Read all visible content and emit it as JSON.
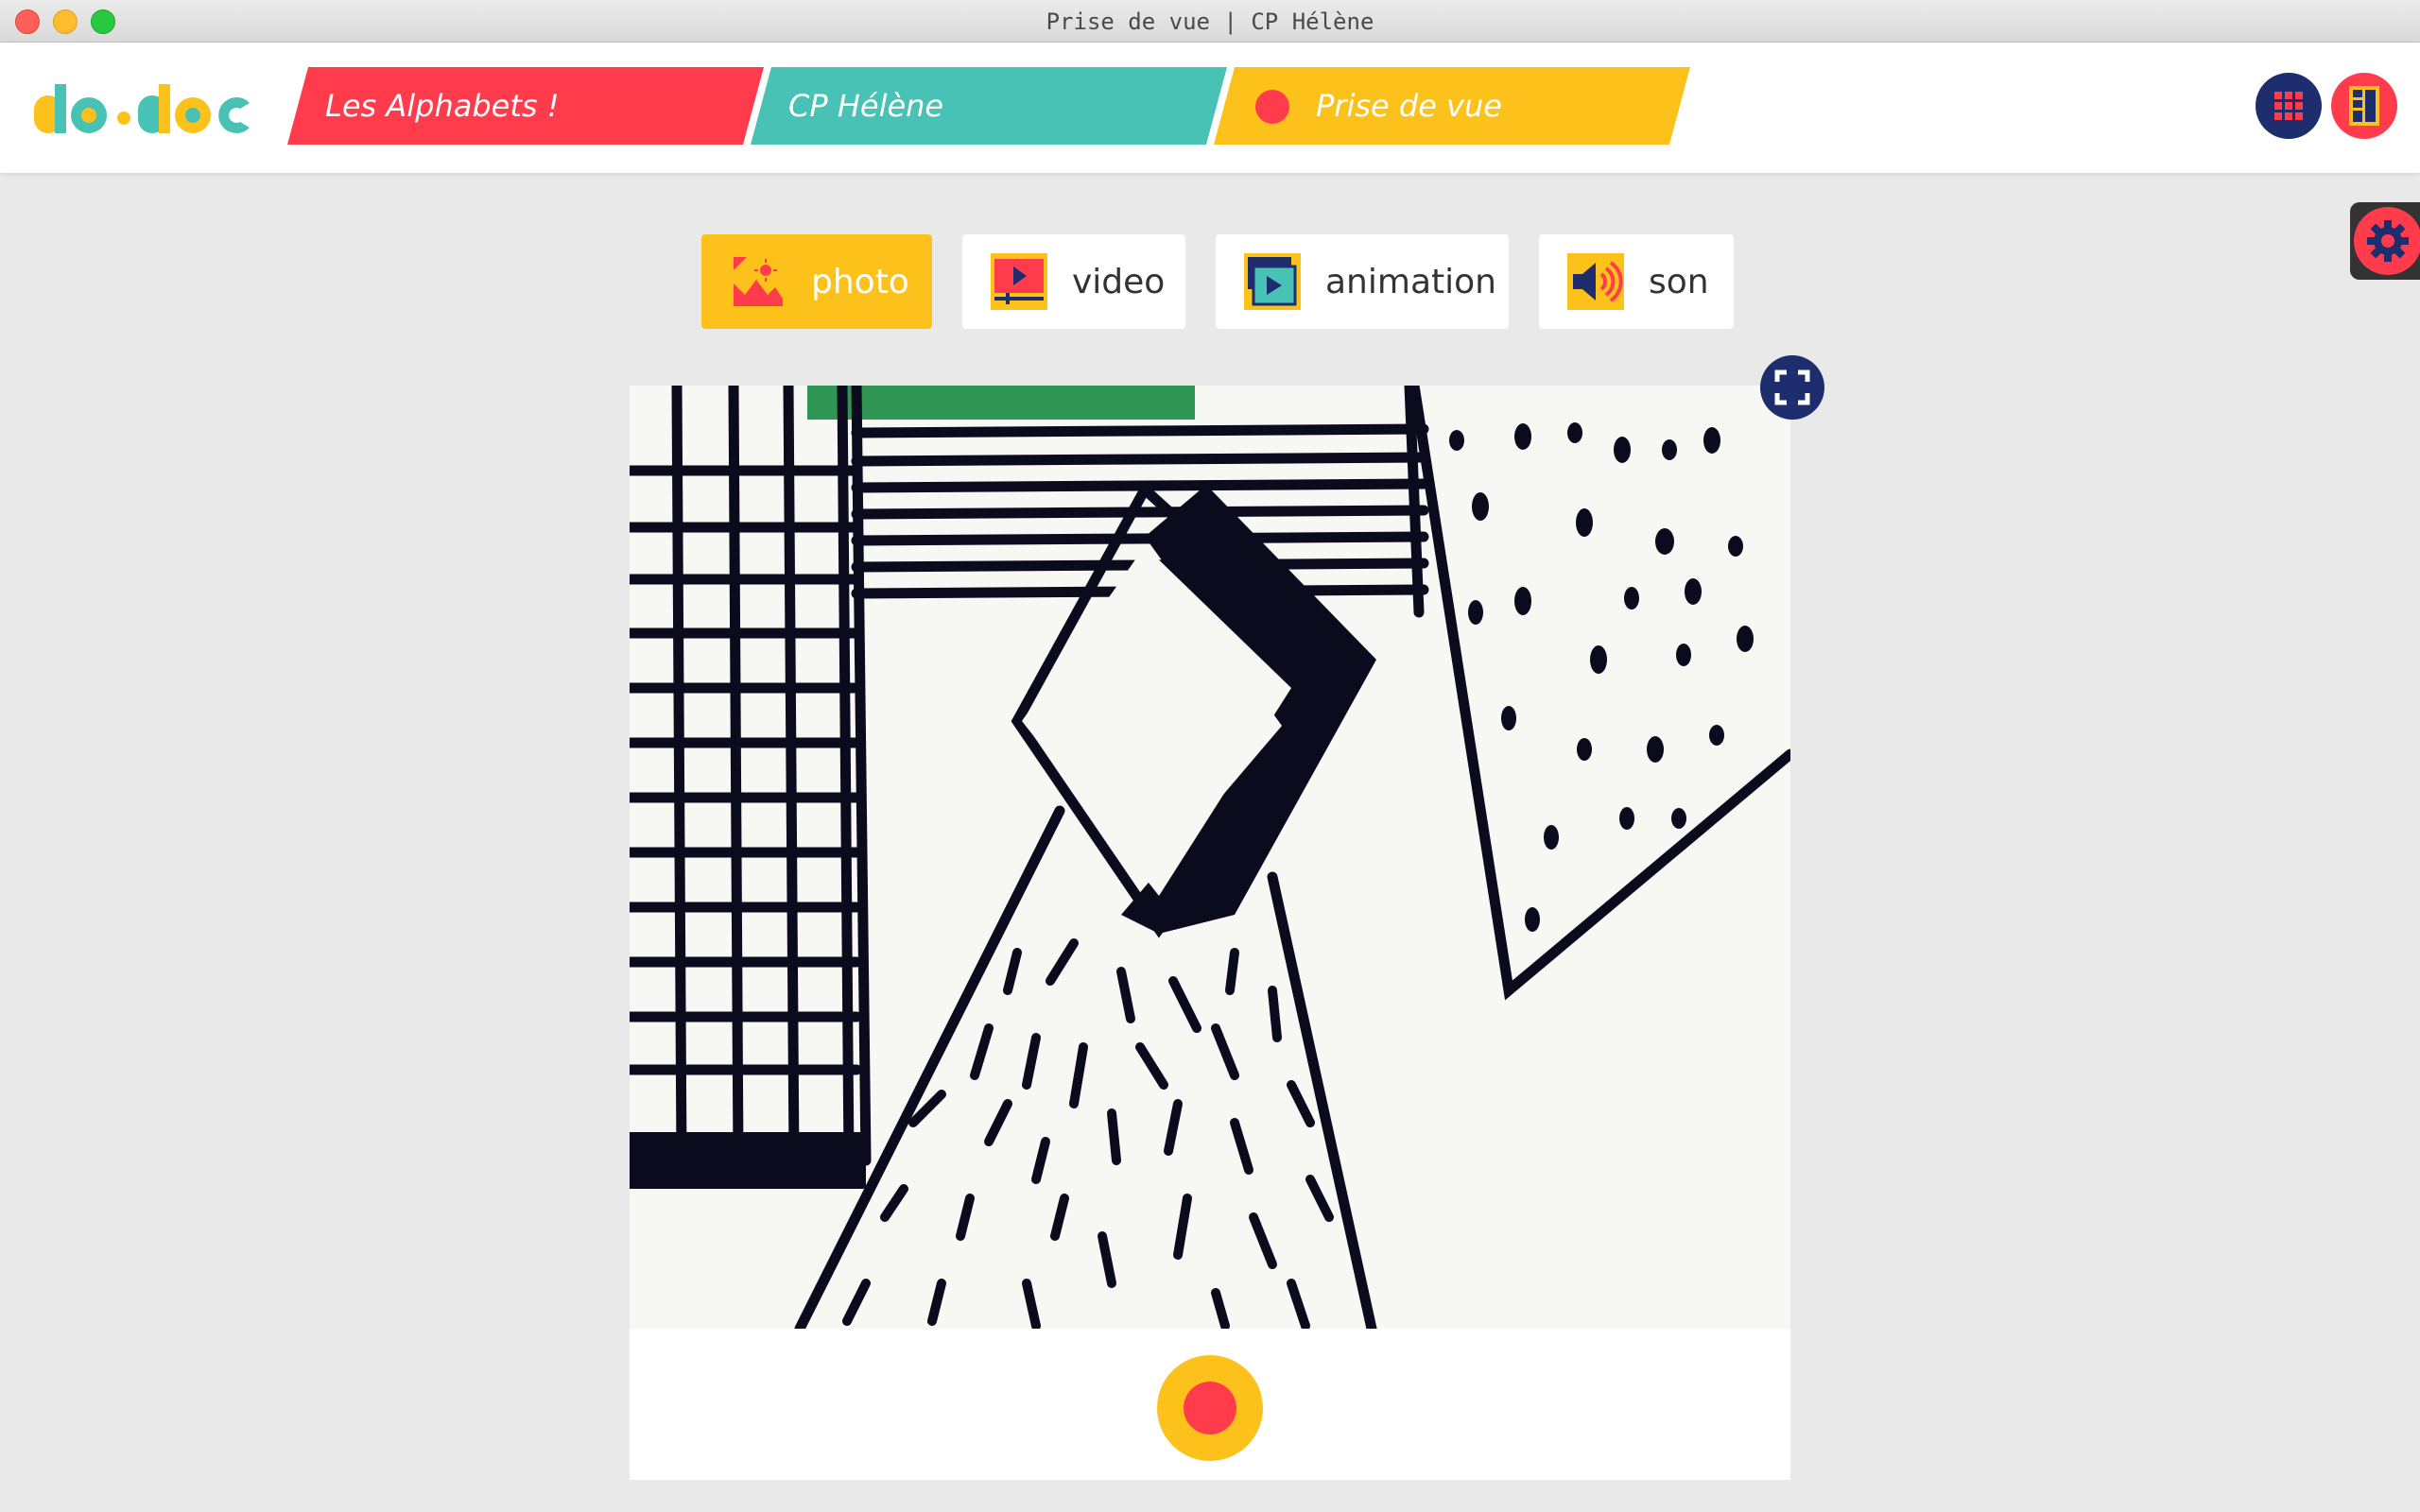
{
  "window": {
    "title": "Prise de vue | CP Hélène"
  },
  "header": {
    "logo_text": "do•doc",
    "breadcrumbs": [
      {
        "label": "Les Alphabets !",
        "color": "#ff3b4c"
      },
      {
        "label": "CP Hélène",
        "color": "#47c2b5"
      },
      {
        "label": "Prise de vue",
        "color": "#fcc21b"
      }
    ],
    "icons": {
      "grid": "grid-icon",
      "layout": "layout-icon"
    }
  },
  "settings": {
    "icon": "gear-icon"
  },
  "modes": {
    "active": "photo",
    "tabs": [
      {
        "id": "photo",
        "label": "photo",
        "icon": "photo-icon"
      },
      {
        "id": "video",
        "label": "video",
        "icon": "video-icon"
      },
      {
        "id": "animation",
        "label": "animation",
        "icon": "animation-icon"
      },
      {
        "id": "son",
        "label": "son",
        "icon": "speaker-icon"
      }
    ]
  },
  "preview": {
    "content": "camera-feed",
    "fullscreen_icon": "fullscreen-icon"
  },
  "capture": {
    "icon": "record-icon"
  },
  "colors": {
    "red": "#ff3b4c",
    "teal": "#47c2b5",
    "yellow": "#fcc21b",
    "navy": "#1d2d6e",
    "background": "#e9e9e9"
  }
}
